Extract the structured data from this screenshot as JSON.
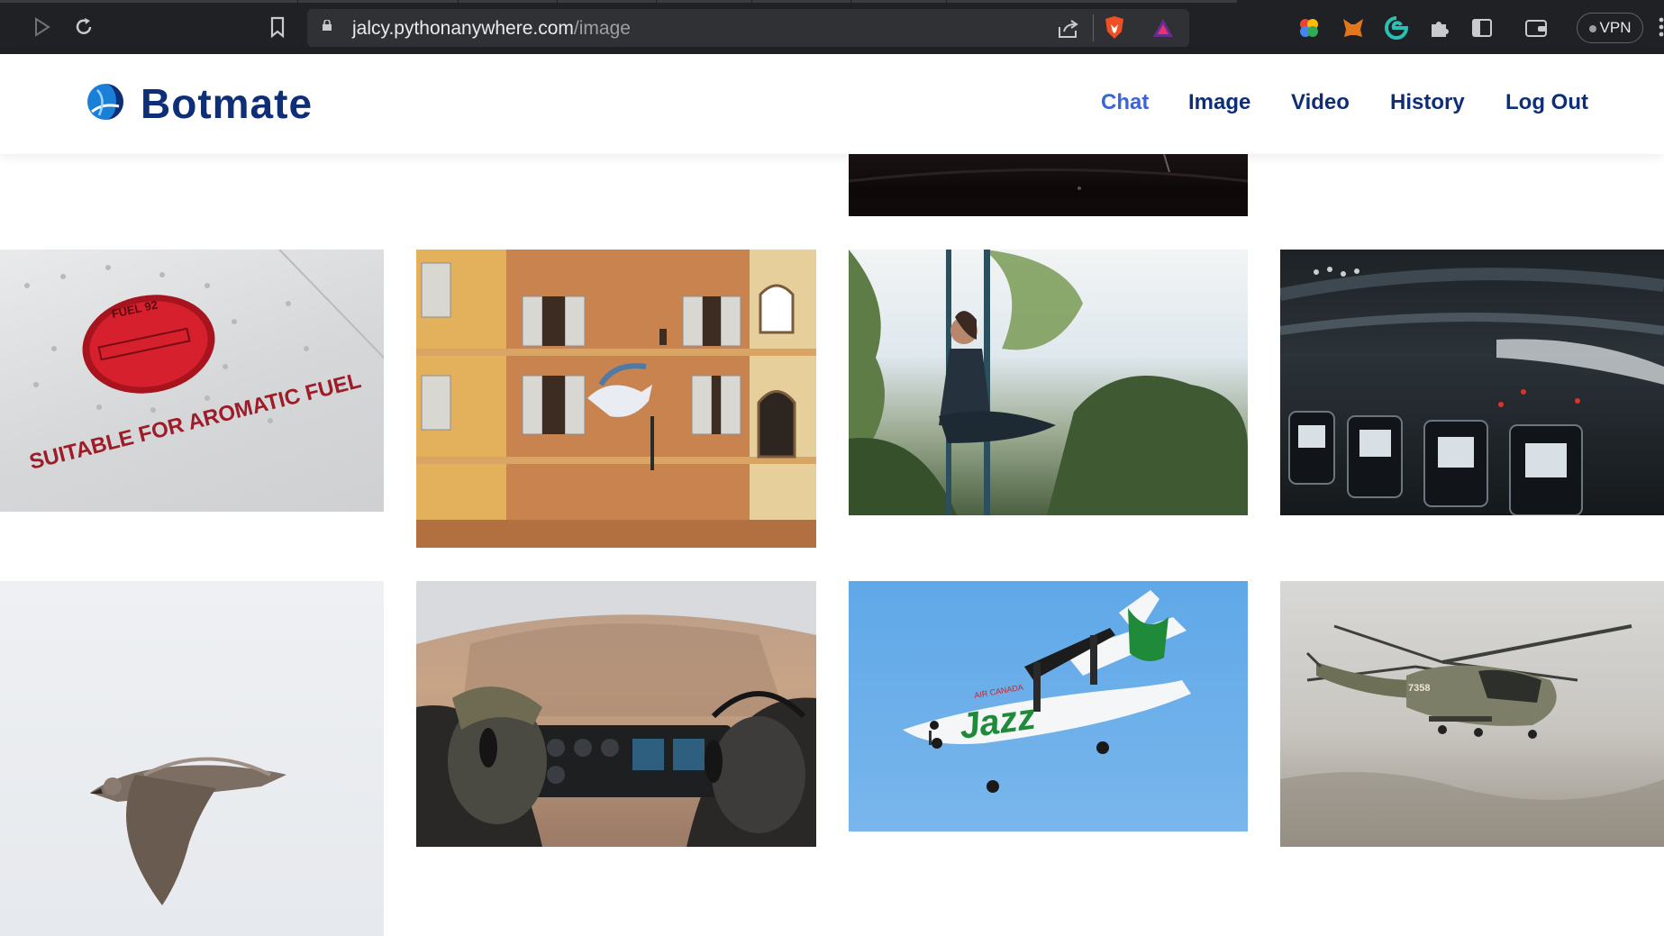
{
  "browser": {
    "url_host": "jalcy.pythonanywhere.com",
    "url_path": "/image",
    "vpn_label": "VPN",
    "icons": [
      "back-icon",
      "forward-icon",
      "reload-icon",
      "bookmark-icon",
      "lock-icon",
      "share-icon",
      "brave-shield-icon",
      "rewards-icon",
      "colorful-extension-icon",
      "metamask-icon",
      "edge-extension-icon",
      "extensions-puzzle-icon",
      "sidebar-icon",
      "wallet-icon",
      "menu-icon"
    ]
  },
  "header": {
    "brand": "Botmate",
    "nav": [
      "Chat",
      "Image",
      "Video",
      "History",
      "Log Out"
    ],
    "active_nav": "Chat",
    "colors": {
      "brand": "#0f2e78",
      "active": "#3b64d9"
    }
  },
  "gallery": {
    "images": [
      {
        "alt": "dark image top"
      },
      {
        "alt": "fuel cap",
        "caption": "SUITABLE FOR AROMATIC FUEL",
        "cap_text": "FUEL 92"
      },
      {
        "alt": "building with flying horse"
      },
      {
        "alt": "woman on aerial silk"
      },
      {
        "alt": "airplane cabin seats"
      },
      {
        "alt": "flying seagull"
      },
      {
        "alt": "helicopter cockpit pilots"
      },
      {
        "alt": "jazz airplane",
        "brand_text": "Jazz",
        "sub_text": "AIR CANADA"
      },
      {
        "alt": "military helicopter",
        "tail_text": "7358"
      }
    ]
  }
}
